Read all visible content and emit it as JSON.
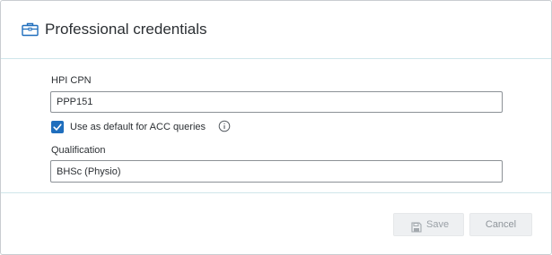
{
  "dialog": {
    "title": "Professional credentials",
    "icon": "briefcase-icon"
  },
  "form": {
    "hpi_cpn_label": "HPI CPN",
    "hpi_cpn_value": "PPP151",
    "default_checkbox_label": "Use as default for ACC queries",
    "default_checkbox_checked": true,
    "info_icon": "info-circle-icon",
    "qualification_label": "Qualification",
    "qualification_value": "BHSc (Physio)"
  },
  "footer": {
    "save_label": "Save",
    "save_icon": "floppy-disk-icon",
    "cancel_label": "Cancel"
  },
  "colors": {
    "accent": "#1f6ebd",
    "divider": "#cfe6ea",
    "disabled_button_bg": "#eef0f2",
    "disabled_text": "#9aa0a6"
  }
}
